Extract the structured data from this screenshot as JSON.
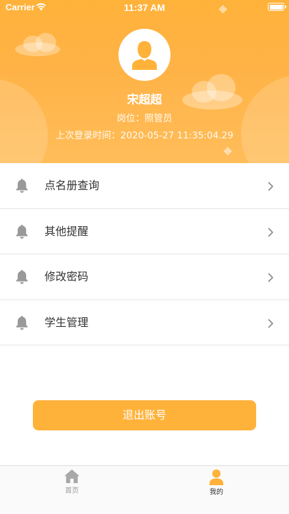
{
  "status_bar": {
    "carrier": "Carrier",
    "time": "11:37 AM"
  },
  "profile": {
    "name": "宋超超",
    "role": "岗位：照管员",
    "last_login": "上次登录时间：2020-05-27 11:35:04.29"
  },
  "menu": {
    "items": [
      {
        "label": "点名册查询",
        "icon": "bell-icon"
      },
      {
        "label": "其他提醒",
        "icon": "bell-icon"
      },
      {
        "label": "修改密码",
        "icon": "bell-icon"
      },
      {
        "label": "学生管理",
        "icon": "bell-icon"
      }
    ]
  },
  "logout": {
    "label": "退出账号"
  },
  "tab_bar": {
    "tabs": [
      {
        "label": "首页",
        "icon": "home-icon",
        "active": false
      },
      {
        "label": "我的",
        "icon": "user-icon",
        "active": true
      }
    ]
  },
  "colors": {
    "accent": "#ffb23a",
    "active_tab_icon": "#ffb23a",
    "inactive_tab_icon": "#a8a8a8",
    "menu_icon": "#999999"
  }
}
